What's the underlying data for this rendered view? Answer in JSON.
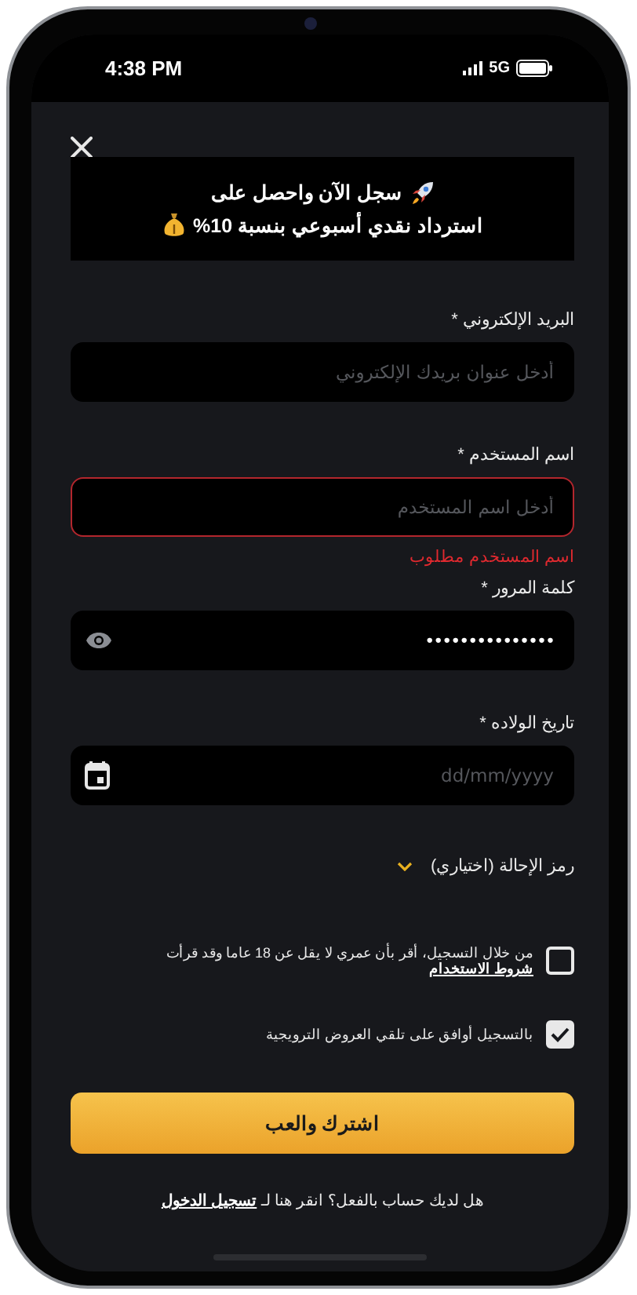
{
  "status_bar": {
    "time": "4:38 PM",
    "network": "5G"
  },
  "banner": {
    "lines": [
      "سجل الآن واحصل على",
      "استرداد نقدي أسبوعي بنسبة 10%"
    ]
  },
  "fields": [
    {
      "kind": "email",
      "label": "البريد الإلكتروني *",
      "placeholder": "أدخل عنوان بريدك الإلكتروني",
      "invalid": false
    },
    {
      "kind": "text",
      "label": "اسم المستخدم *",
      "placeholder": "أدخل اسم المستخدم",
      "invalid": true,
      "error": "اسم المستخدم مطلوب"
    },
    {
      "kind": "password",
      "label": "كلمة المرور *",
      "value": "•••••••••••••••",
      "invalid": false
    },
    {
      "kind": "date",
      "label": "تاريخ الولاده *",
      "placeholder": "dd/mm/yyyy",
      "invalid": false
    }
  ],
  "referral": {
    "label": "رمز الإحالة (اختياري)",
    "expanded": false
  },
  "checkboxes": [
    {
      "text": "من خلال التسجيل، أقر بأن عمري لا يقل عن 18 عاما وقد قرأت",
      "link": "شروط الاستخدام",
      "checked": false
    },
    {
      "text": "بالتسجيل أوافق على تلقي العروض الترويجية",
      "checked": true
    }
  ],
  "submit_button": {
    "label": "اشترك والعب"
  },
  "footer": {
    "text": "هل لديك حساب بالفعل؟ انقر هنا لـ",
    "link": "تسجيل الدخول"
  }
}
